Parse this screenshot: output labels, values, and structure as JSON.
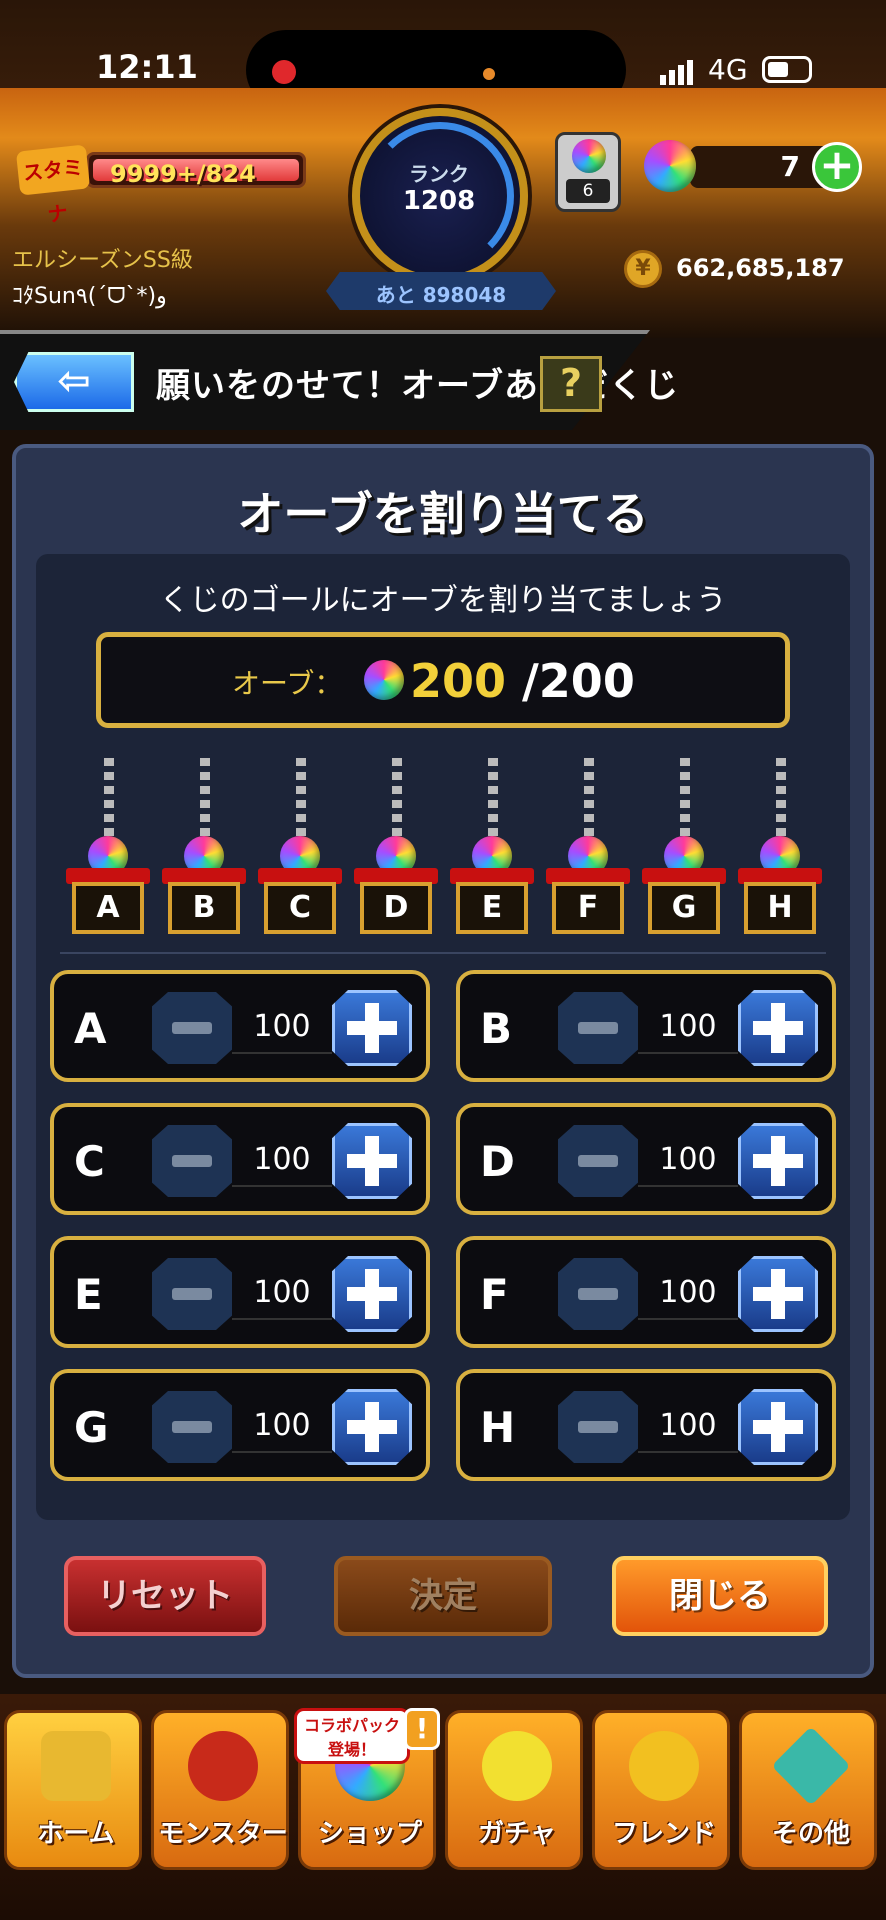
{
  "status_bar": {
    "time": "12:11",
    "network": "4G"
  },
  "header": {
    "stamina_label": "スタミナ",
    "stamina_value": "9999+",
    "stamina_max": "/824",
    "rank_label": "ランク",
    "rank_value": "1208",
    "rank_next": "あと 898048",
    "gauge_count": "6",
    "orb_count": "7",
    "orb_add": "+",
    "player_title": "エルシーズンSS級",
    "player_name": "ｺﾀSun٩(ˊᗜˋ*)و",
    "coins": "662,685,187"
  },
  "titlebar": {
    "back_glyph": "⇦",
    "title": "願いをのせて！オーブあみだくじ",
    "help": "?"
  },
  "panel": {
    "title": "オーブを割り当てる",
    "subtitle": "くじのゴールにオーブを割り当てましょう",
    "orb_label": "オーブ：",
    "orb_current": "200",
    "orb_total": "/200"
  },
  "goals": [
    "A",
    "B",
    "C",
    "D",
    "E",
    "F",
    "G",
    "H"
  ],
  "allocations": [
    {
      "label": "A",
      "value": "100"
    },
    {
      "label": "B",
      "value": "100"
    },
    {
      "label": "C",
      "value": "100"
    },
    {
      "label": "D",
      "value": "100"
    },
    {
      "label": "E",
      "value": "100"
    },
    {
      "label": "F",
      "value": "100"
    },
    {
      "label": "G",
      "value": "100"
    },
    {
      "label": "H",
      "value": "100"
    }
  ],
  "buttons": {
    "reset": "リセット",
    "decide": "決定",
    "close": "閉じる"
  },
  "nav": {
    "home": "ホーム",
    "monster": "モンスター",
    "shop": "ショップ",
    "shop_badge": "コラボパック登場！",
    "shop_alert": "!",
    "gacha": "ガチャ",
    "friend": "フレンド",
    "other": "その他"
  },
  "colors": {
    "accent_gold": "#d8b040",
    "orb_count_gold": "#f2d03a",
    "plus_blue": "#3a78d8",
    "close_orange": "#ff9a2a",
    "reset_red": "#c83030"
  }
}
